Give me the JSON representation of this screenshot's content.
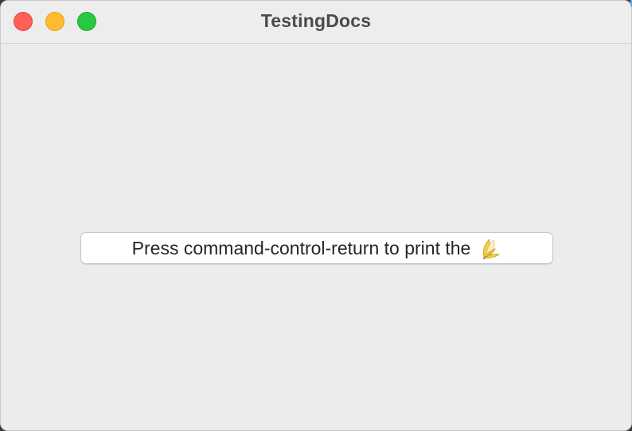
{
  "window": {
    "title": "TestingDocs"
  },
  "traffic_lights": {
    "close_color": "#ff5f57",
    "minimize_color": "#febc2e",
    "zoom_color": "#28c840"
  },
  "main": {
    "button": {
      "label": "Press command-control-return to print the",
      "icon": "banana-icon"
    }
  }
}
